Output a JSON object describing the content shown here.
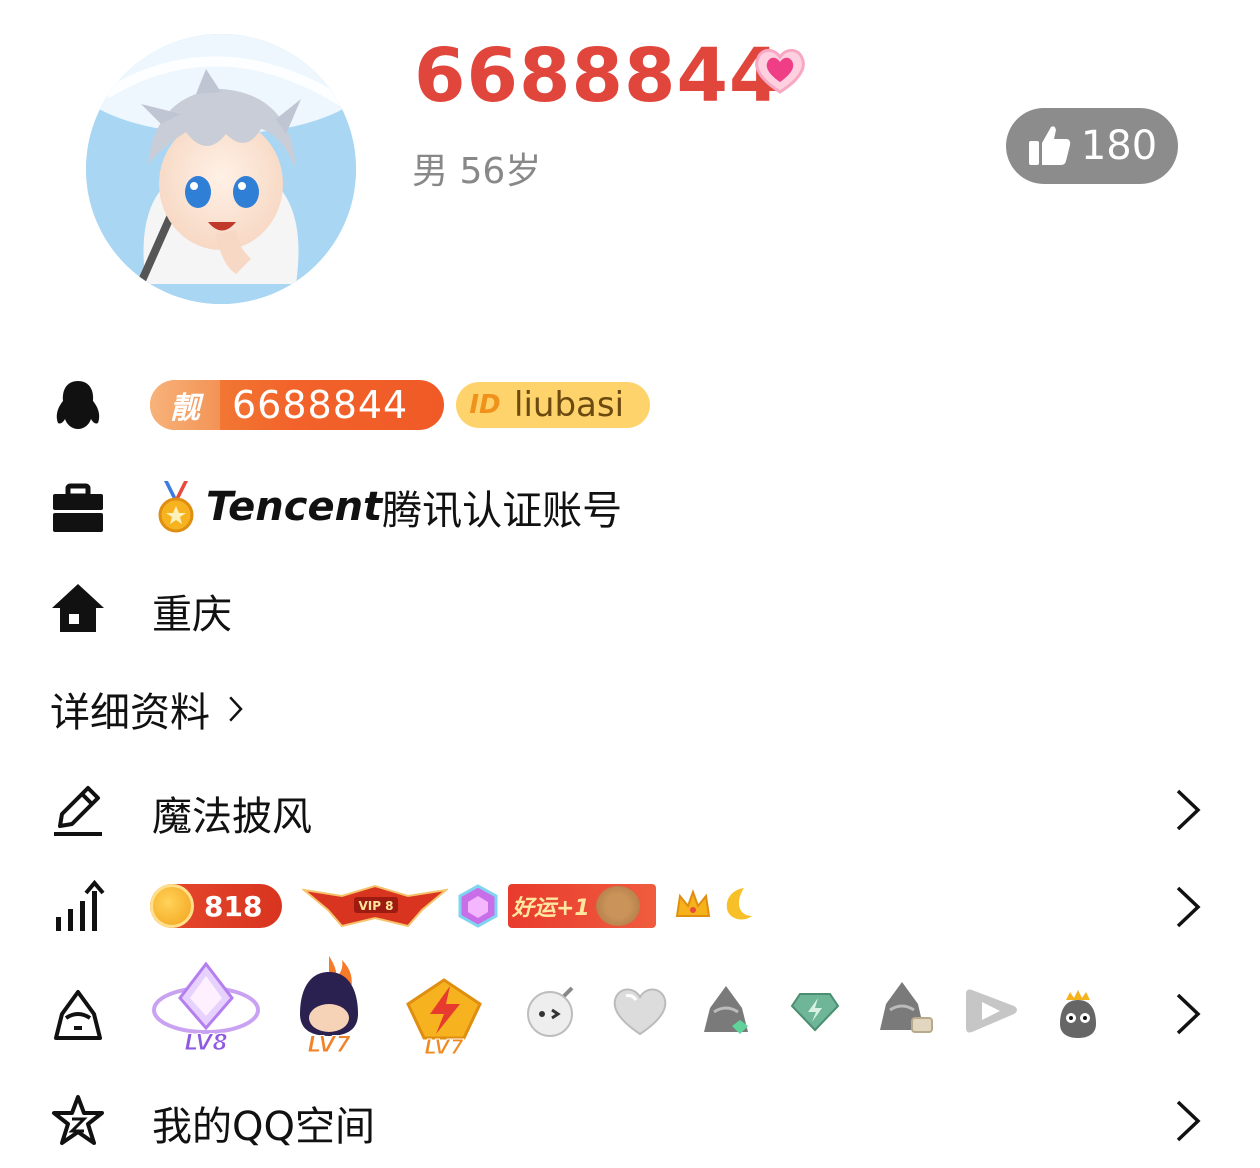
{
  "profile": {
    "nickname": "6688844",
    "gender_age": "男 56岁",
    "like_count": "180"
  },
  "accounts": {
    "liang_label": "靓",
    "qq_number": "6688844",
    "id_label": "ID",
    "qid": "liubasi"
  },
  "certification": {
    "brand": "Tencent",
    "text": "腾讯认证账号"
  },
  "location": {
    "city": "重庆"
  },
  "details_link": {
    "label": "详细资料"
  },
  "magic_cape": {
    "label": "魔法披风"
  },
  "growth": {
    "coin_value": "818",
    "vip_label": "VIP 8",
    "luck_label": "好运+1"
  },
  "game_levels": {
    "badges": [
      "LV8",
      "LV7",
      "LV7"
    ]
  },
  "qzone": {
    "label": "我的QQ空间"
  },
  "colors": {
    "nickname": "#e0463c",
    "like_pill_bg": "#8c8c8c",
    "qq_pill": "#f2622a",
    "id_pill": "#ffd36b"
  },
  "icons": {
    "penguin": "penguin-icon",
    "briefcase": "briefcase-icon",
    "home": "home-icon",
    "pencil": "pencil-icon",
    "growth": "growth-chart-icon",
    "hat": "penguin-hat-icon",
    "star": "star-icon",
    "chevron": "chevron-right-icon",
    "thumb": "thumbs-up-icon"
  }
}
